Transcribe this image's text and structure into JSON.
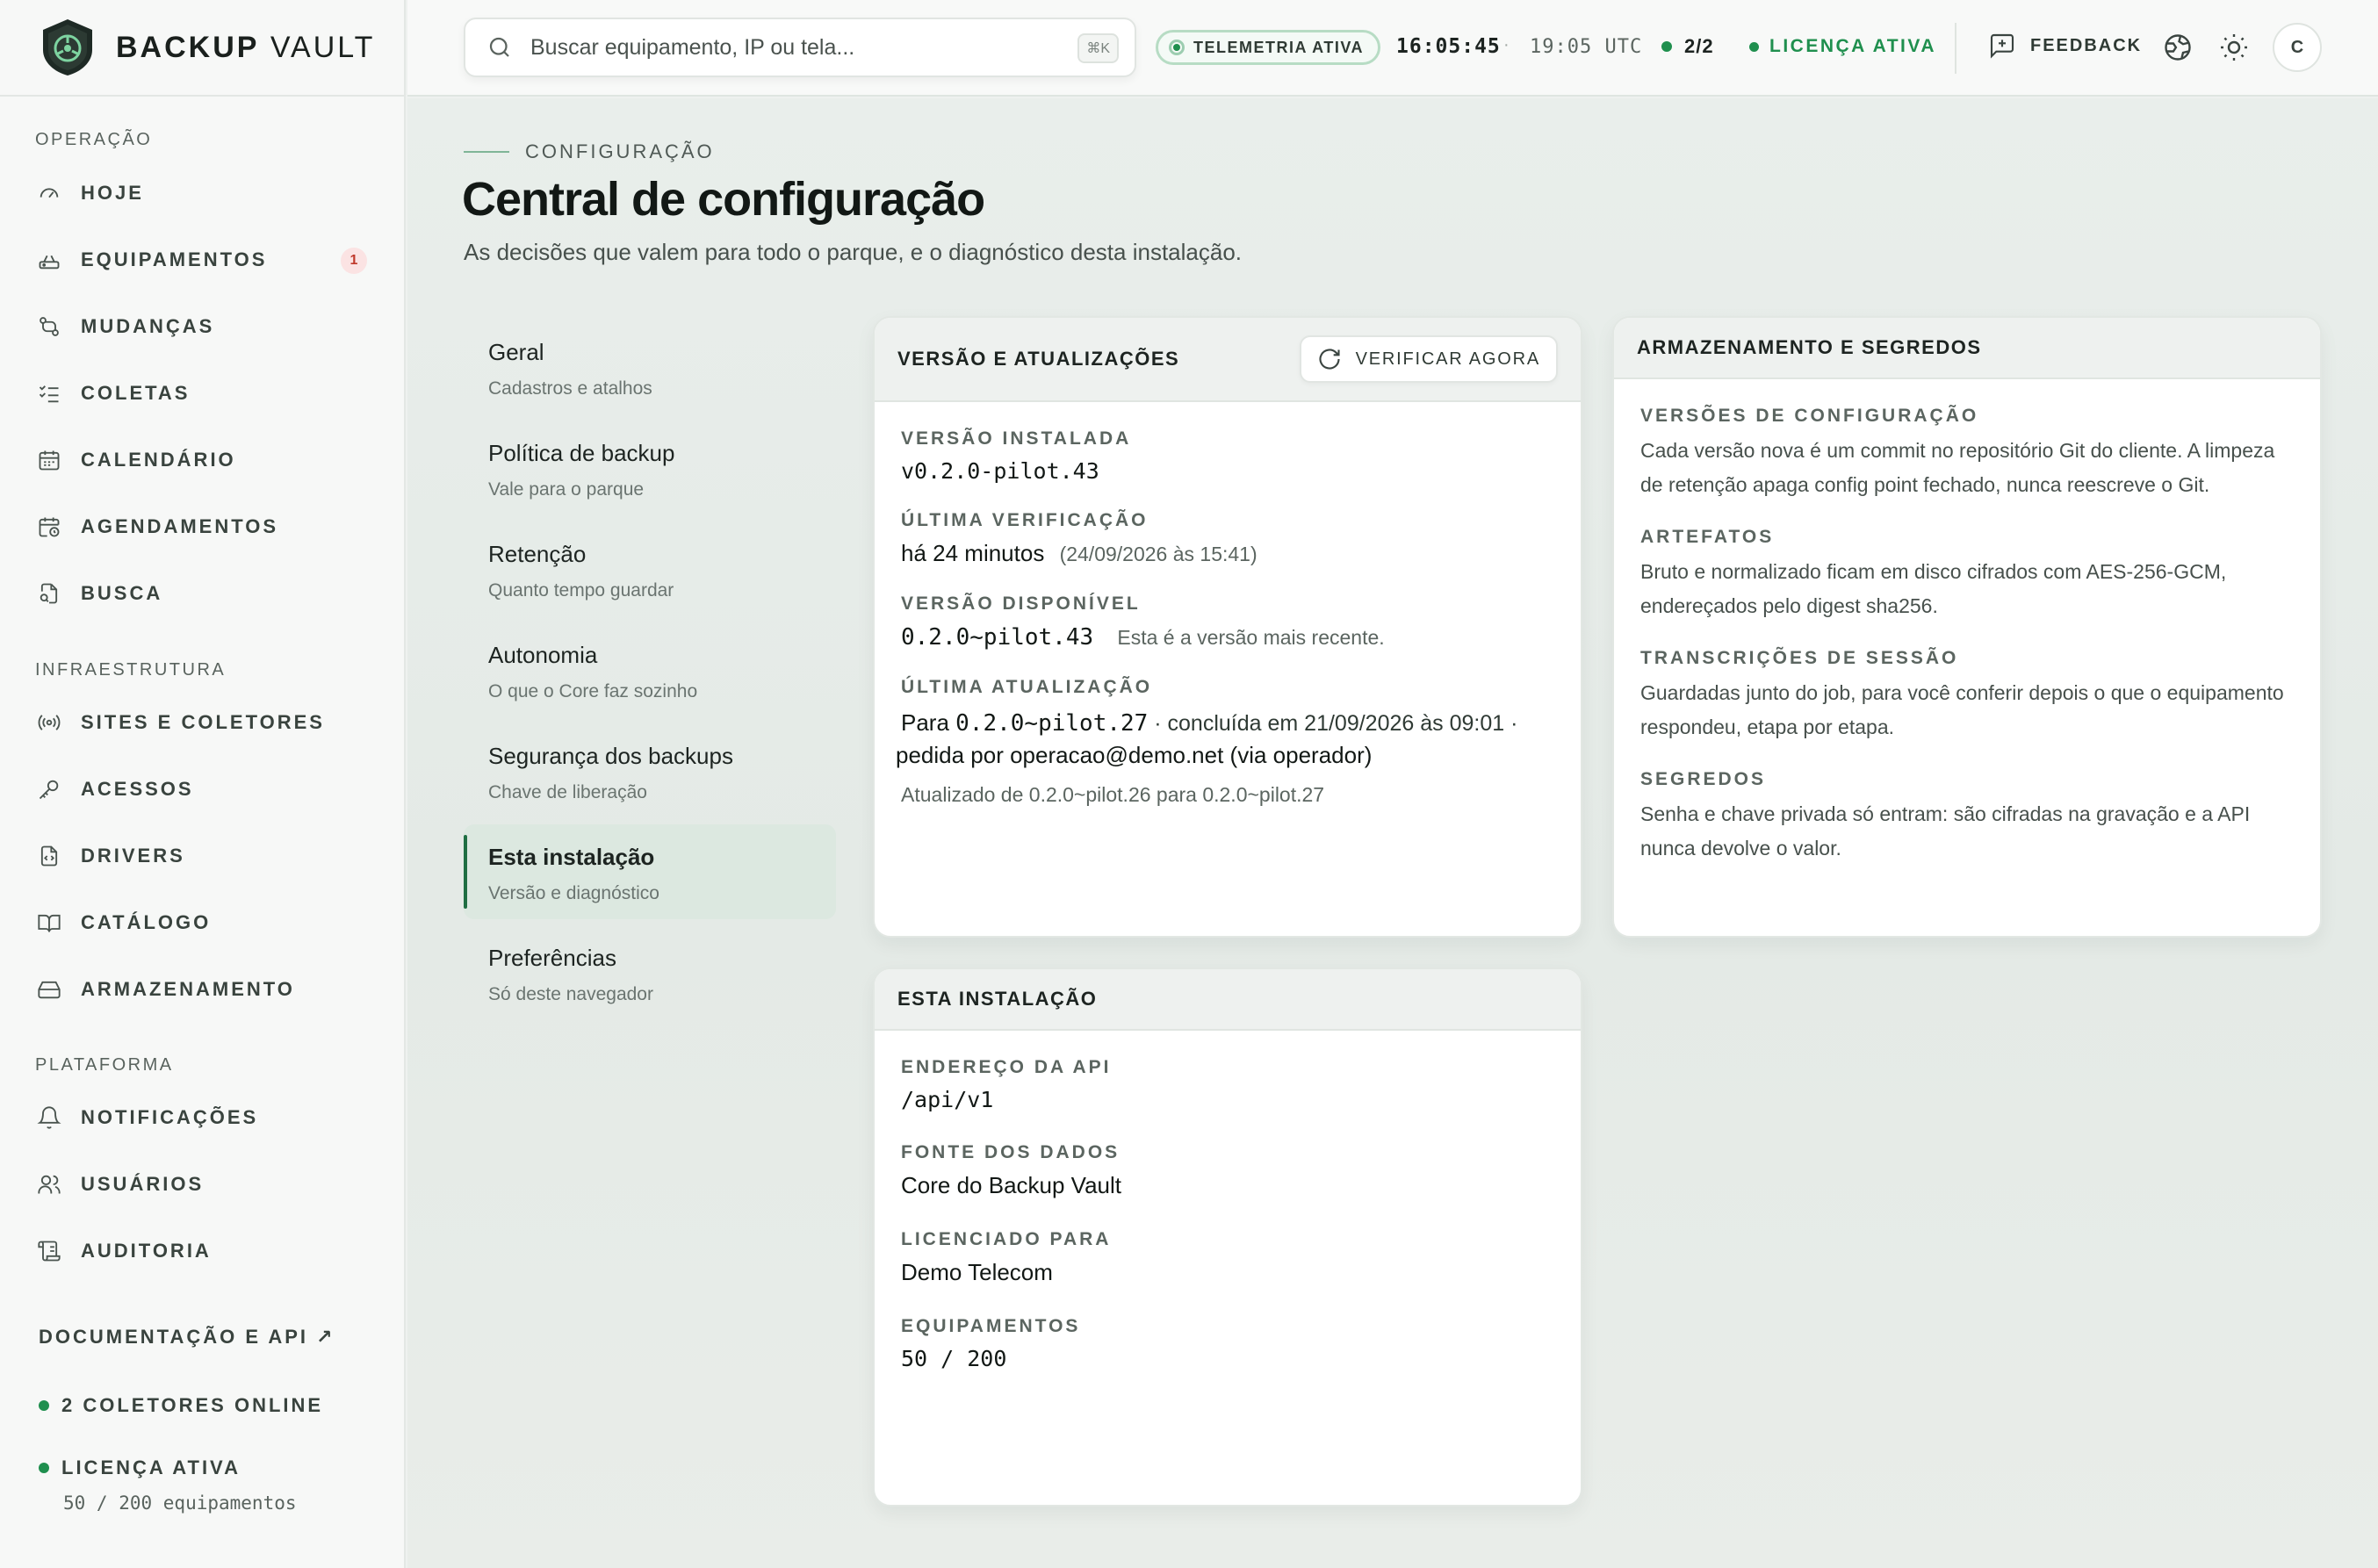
{
  "brand": {
    "name_bold": "BACKUP",
    "name_light": "VAULT"
  },
  "sidebar": {
    "sections": [
      {
        "title": "OPERAÇÃO",
        "items": [
          {
            "label": "HOJE",
            "icon": "gauge-icon"
          },
          {
            "label": "EQUIPAMENTOS",
            "icon": "router-icon",
            "badge": "1"
          },
          {
            "label": "MUDANÇAS",
            "icon": "git-diff-icon"
          },
          {
            "label": "COLETAS",
            "icon": "checklist-icon"
          },
          {
            "label": "CALENDÁRIO",
            "icon": "calendar-icon"
          },
          {
            "label": "AGENDAMENTOS",
            "icon": "calendar-clock-icon"
          },
          {
            "label": "BUSCA",
            "icon": "file-search-icon"
          }
        ]
      },
      {
        "title": "INFRAESTRUTURA",
        "items": [
          {
            "label": "SITES E COLETORES",
            "icon": "radio-icon"
          },
          {
            "label": "ACESSOS",
            "icon": "key-icon"
          },
          {
            "label": "DRIVERS",
            "icon": "file-code-icon"
          },
          {
            "label": "CATÁLOGO",
            "icon": "book-icon"
          },
          {
            "label": "ARMAZENAMENTO",
            "icon": "hard-drive-icon"
          }
        ]
      },
      {
        "title": "PLATAFORMA",
        "items": [
          {
            "label": "NOTIFICAÇÕES",
            "icon": "bell-icon"
          },
          {
            "label": "USUÁRIOS",
            "icon": "users-icon"
          },
          {
            "label": "AUDITORIA",
            "icon": "scroll-icon"
          }
        ]
      }
    ],
    "docs_link": "DOCUMENTAÇÃO E API ↗",
    "collectors_status": "2 COLETORES ONLINE",
    "license_status": "LICENÇA ATIVA",
    "license_usage": "50 / 200 equipamentos"
  },
  "topbar": {
    "search_placeholder": "Buscar equipamento, IP ou tela...",
    "search_shortcut": "⌘K",
    "telemetry": "TELEMETRIA ATIVA",
    "local_time": "16:05:45",
    "separator": "·",
    "utc_time": "19:05 UTC",
    "collectors": "2/2",
    "license": "LICENÇA ATIVA",
    "feedback": "FEEDBACK",
    "avatar_initial": "C"
  },
  "page": {
    "eyebrow": "CONFIGURAÇÃO",
    "title": "Central de configuração",
    "subtitle": "As decisões que valem para todo o parque, e o diagnóstico desta instalação."
  },
  "subnav": [
    {
      "title": "Geral",
      "subtitle": "Cadastros e atalhos",
      "active": false
    },
    {
      "title": "Política de backup",
      "subtitle": "Vale para o parque",
      "active": false
    },
    {
      "title": "Retenção",
      "subtitle": "Quanto tempo guardar",
      "active": false
    },
    {
      "title": "Autonomia",
      "subtitle": "O que o Core faz sozinho",
      "active": false
    },
    {
      "title": "Segurança dos backups",
      "subtitle": "Chave de liberação",
      "active": false
    },
    {
      "title": "Esta instalação",
      "subtitle": "Versão e diagnóstico",
      "active": true
    },
    {
      "title": "Preferências",
      "subtitle": "Só deste navegador",
      "active": false
    }
  ],
  "version_card": {
    "title": "VERSÃO E ATUALIZAÇÕES",
    "verify_button": "VERIFICAR AGORA",
    "installed_label": "VERSÃO INSTALADA",
    "installed_value": "v0.2.0-pilot.43",
    "last_check_label": "ÚLTIMA VERIFICAÇÃO",
    "last_check_value": "há 24 minutos",
    "last_check_date": "(24/09/2026 às 15:41)",
    "available_label": "VERSÃO DISPONÍVEL",
    "available_value": "0.2.0~pilot.43",
    "available_note": "Esta é a versão mais recente.",
    "last_update_label": "ÚLTIMA ATUALIZAÇÃO",
    "last_update_prefix": "Para",
    "last_update_version": "0.2.0~pilot.27",
    "last_update_done": " · concluída em 21/09/2026 às 09:01 ·",
    "last_update_by": "pedida por operacao@demo.net (via operador)",
    "last_update_detail": "Atualizado de 0.2.0~pilot.26 para 0.2.0~pilot.27"
  },
  "storage_card": {
    "title": "ARMAZENAMENTO E SEGREDOS",
    "items": [
      {
        "label": "VERSÕES DE CONFIGURAÇÃO",
        "text": "Cada versão nova é um commit no repositório Git do cliente. A limpeza de retenção apaga config point fechado, nunca reescreve o Git."
      },
      {
        "label": "ARTEFATOS",
        "text": "Bruto e normalizado ficam em disco cifrados com AES-256-GCM, endereçados pelo digest sha256."
      },
      {
        "label": "TRANSCRIÇÕES DE SESSÃO",
        "text": "Guardadas junto do job, para você conferir depois o que o equipamento respondeu, etapa por etapa."
      },
      {
        "label": "SEGREDOS",
        "text": "Senha e chave privada só entram: são cifradas na gravação e a API nunca devolve o valor."
      }
    ]
  },
  "install_card": {
    "title": "ESTA INSTALAÇÃO",
    "api_label": "ENDEREÇO DA API",
    "api_value": "/api/v1",
    "source_label": "FONTE DOS DADOS",
    "source_value": "Core do Backup Vault",
    "licensed_label": "LICENCIADO PARA",
    "licensed_value": "Demo Telecom",
    "devices_label": "EQUIPAMENTOS",
    "devices_value": "50 / 200"
  },
  "colors": {
    "accent": "#1f8f4e",
    "accent_dark": "#1f6e42",
    "badge_bg": "#fbe3e3",
    "badge_fg": "#c0392b"
  }
}
